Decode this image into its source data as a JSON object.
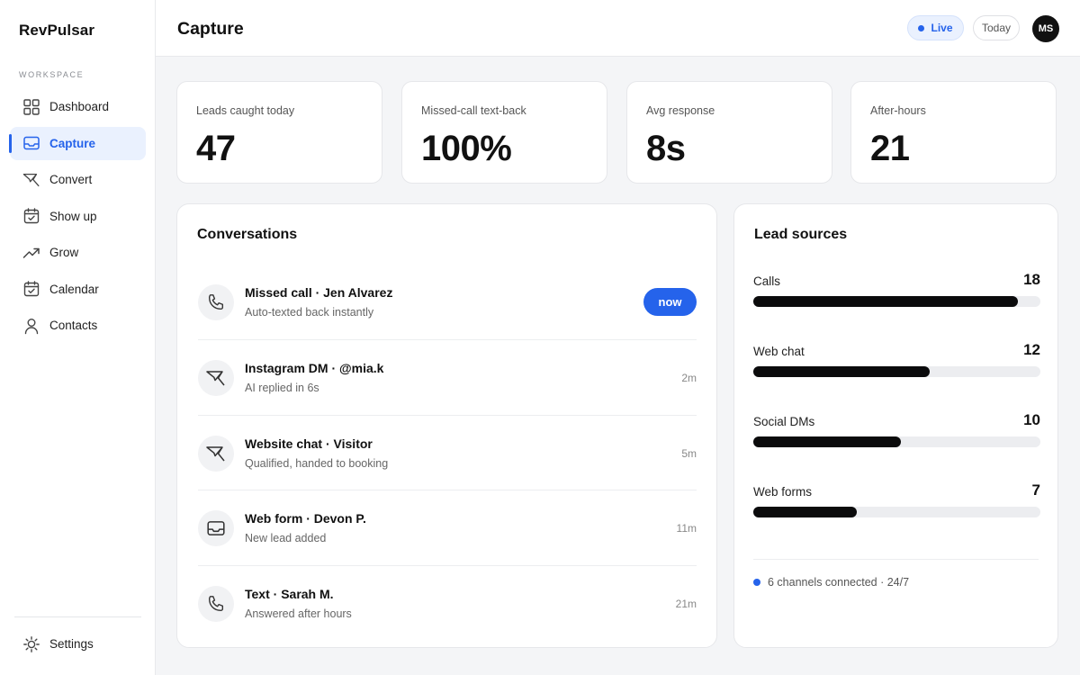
{
  "brand": "RevPulsar",
  "sidebar": {
    "section_label": "WORKSPACE",
    "items": [
      {
        "label": "Dashboard",
        "icon": "grid-icon"
      },
      {
        "label": "Capture",
        "icon": "inbox-icon",
        "active": true
      },
      {
        "label": "Convert",
        "icon": "send-icon"
      },
      {
        "label": "Show up",
        "icon": "calendar-check-icon"
      },
      {
        "label": "Grow",
        "icon": "trend-up-icon"
      },
      {
        "label": "Calendar",
        "icon": "calendar-icon"
      },
      {
        "label": "Contacts",
        "icon": "user-icon"
      }
    ],
    "settings_label": "Settings"
  },
  "header": {
    "title": "Capture",
    "live_label": "Live",
    "today_label": "Today",
    "avatar_initials": "MS"
  },
  "stats": [
    {
      "label": "Leads caught today",
      "value": "47"
    },
    {
      "label": "Missed-call text-back",
      "value": "100%"
    },
    {
      "label": "Avg response",
      "value": "8s"
    },
    {
      "label": "After-hours",
      "value": "21"
    }
  ],
  "conversations": {
    "title": "Conversations",
    "items": [
      {
        "title": "Missed call · Jen Alvarez",
        "subtitle": "Auto-texted back instantly",
        "time": "now",
        "icon": "phone-icon"
      },
      {
        "title": "Instagram DM · @mia.k",
        "subtitle": "AI replied in 6s",
        "time": "2m",
        "icon": "send-icon"
      },
      {
        "title": "Website chat · Visitor",
        "subtitle": "Qualified, handed to booking",
        "time": "5m",
        "icon": "send-icon"
      },
      {
        "title": "Web form · Devon P.",
        "subtitle": "New lead added",
        "time": "11m",
        "icon": "inbox-icon"
      },
      {
        "title": "Text · Sarah M.",
        "subtitle": "Answered after hours",
        "time": "21m",
        "icon": "phone-icon"
      }
    ]
  },
  "lead_sources": {
    "title": "Lead sources",
    "max": 19.5,
    "items": [
      {
        "name": "Calls",
        "value": 18
      },
      {
        "name": "Web chat",
        "value": 12
      },
      {
        "name": "Social DMs",
        "value": 10
      },
      {
        "name": "Web forms",
        "value": 7
      }
    ],
    "footer": "6 channels connected · 24/7"
  },
  "colors": {
    "accent": "#2563eb",
    "bar": "#0b0b0c",
    "track": "#ecedf0"
  }
}
